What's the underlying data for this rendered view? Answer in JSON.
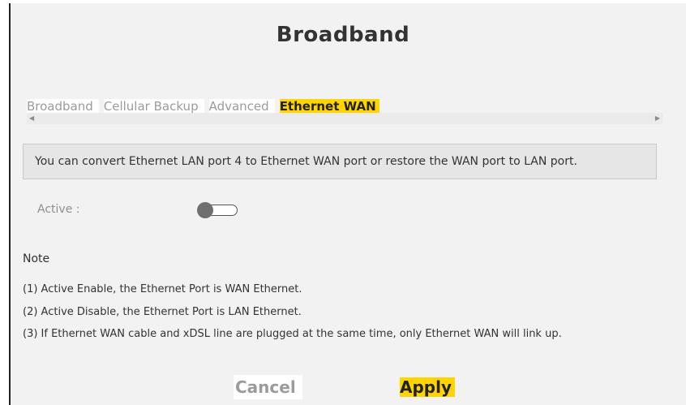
{
  "page": {
    "title": "Broadband"
  },
  "tabs": [
    {
      "label": "Broadband",
      "active": false
    },
    {
      "label": "Cellular Backup",
      "active": false
    },
    {
      "label": "Advanced",
      "active": false
    },
    {
      "label": "Ethernet WAN",
      "active": true
    }
  ],
  "scrollbar": {
    "left_icon": "scroll-left-arrow-icon",
    "right_icon": "scroll-right-arrow-icon"
  },
  "info": {
    "text": "You can convert Ethernet LAN port 4 to Ethernet WAN port or restore the WAN port to LAN port."
  },
  "active_setting": {
    "label": "Active :",
    "enabled": false
  },
  "note": {
    "title": "Note",
    "lines": [
      "(1) Active Enable, the Ethernet Port is WAN Ethernet.",
      "(2) Active Disable, the Ethernet Port is LAN Ethernet.",
      "(3) If Ethernet WAN cable and xDSL line are plugged at the same time, only Ethernet WAN will link up."
    ]
  },
  "buttons": {
    "cancel": "Cancel",
    "apply": "Apply"
  },
  "colors": {
    "accent": "#ffd400",
    "background": "#f2f2f2",
    "text": "#333333",
    "muted": "#9b9b9b"
  }
}
